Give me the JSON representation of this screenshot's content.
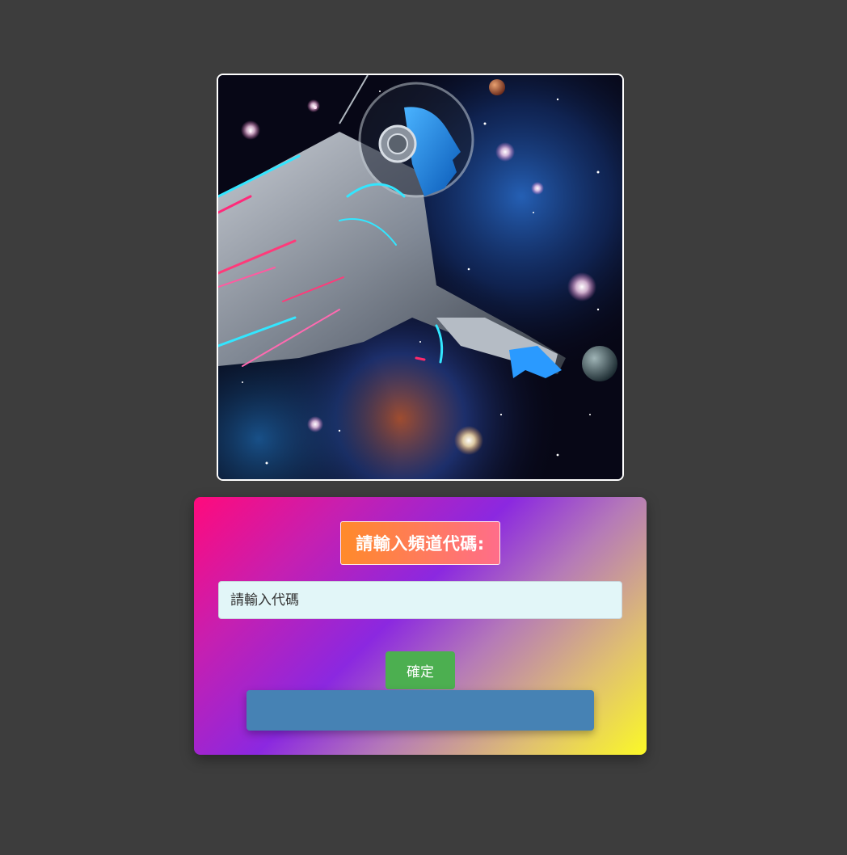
{
  "hero": {
    "icon": "astronaut-space-image"
  },
  "form": {
    "title": "請輸入頻道代碼:",
    "code_input": {
      "placeholder": "請輸入代碼",
      "value": ""
    },
    "submit_label": "確定",
    "result_text": ""
  },
  "colors": {
    "background": "#3d3d3d",
    "submit_button": "#4caf50",
    "result_bar": "#4682b4",
    "input_background": "#e2f6f8",
    "card_gradient": [
      "#ff0a7c",
      "#8b28e0",
      "#fbf927"
    ],
    "title_gradient": [
      "#ff8a2a",
      "#ff6d8a"
    ]
  }
}
